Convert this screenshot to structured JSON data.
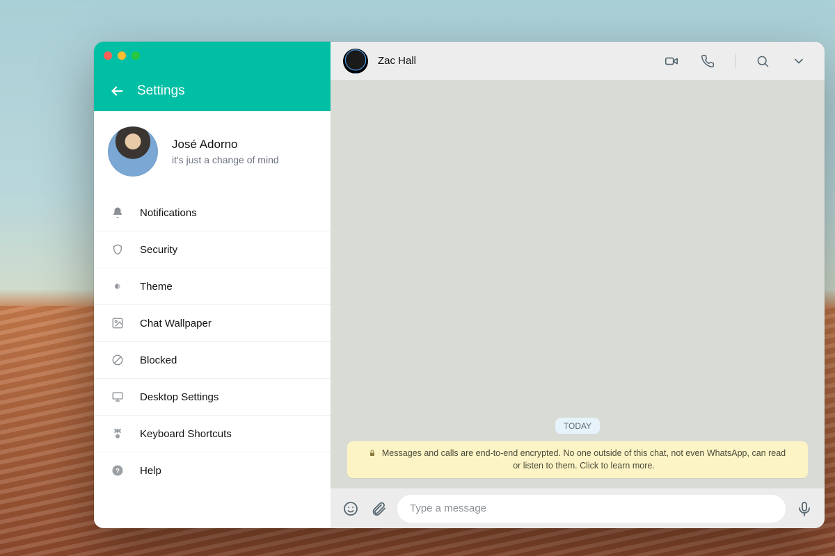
{
  "sidebar": {
    "title": "Settings",
    "profile": {
      "name": "José Adorno",
      "status": "it's just a change of mind"
    },
    "items": [
      {
        "icon": "bell-icon",
        "label": "Notifications"
      },
      {
        "icon": "shield-icon",
        "label": "Security"
      },
      {
        "icon": "theme-icon",
        "label": "Theme"
      },
      {
        "icon": "wallpaper-icon",
        "label": "Chat Wallpaper"
      },
      {
        "icon": "blocked-icon",
        "label": "Blocked"
      },
      {
        "icon": "desktop-icon",
        "label": "Desktop Settings"
      },
      {
        "icon": "keyboard-icon",
        "label": "Keyboard Shortcuts"
      },
      {
        "icon": "help-icon",
        "label": "Help"
      }
    ]
  },
  "chat": {
    "contact_name": "Zac Hall",
    "date_label": "TODAY",
    "encryption_notice": "Messages and calls are end-to-end encrypted. No one outside of this chat, not even WhatsApp, can read or listen to them. Click to learn more.",
    "composer_placeholder": "Type a message"
  },
  "colors": {
    "accent": "#00bfa5",
    "banner_bg": "#fdf4c5",
    "chat_bg": "#d9dbd5"
  }
}
